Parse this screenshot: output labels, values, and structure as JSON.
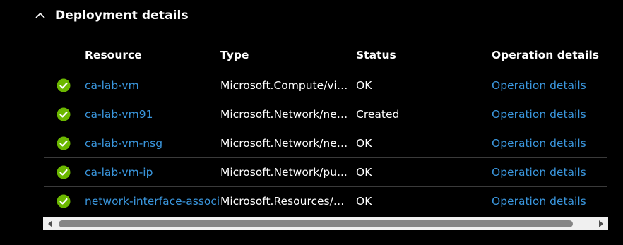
{
  "section": {
    "title": "Deployment details",
    "chevron_icon": "chevron-up-icon"
  },
  "table": {
    "headers": {
      "resource": "Resource",
      "type": "Type",
      "status": "Status",
      "operation": "Operation details"
    },
    "rows": [
      {
        "status_icon": "success-check-icon",
        "resource": "ca-lab-vm",
        "type": "Microsoft.Compute/vir...",
        "status": "OK",
        "operation": "Operation details"
      },
      {
        "status_icon": "success-check-icon",
        "resource": "ca-lab-vm91",
        "type": "Microsoft.Network/net...",
        "status": "Created",
        "operation": "Operation details"
      },
      {
        "status_icon": "success-check-icon",
        "resource": "ca-lab-vm-nsg",
        "type": "Microsoft.Network/net...",
        "status": "OK",
        "operation": "Operation details"
      },
      {
        "status_icon": "success-check-icon",
        "resource": "ca-lab-vm-ip",
        "type": "Microsoft.Network/pu...",
        "status": "OK",
        "operation": "Operation details"
      },
      {
        "status_icon": "success-check-icon",
        "resource": "network-interface-associ",
        "type": "Microsoft.Resources/d...",
        "status": "OK",
        "operation": "Operation details"
      }
    ]
  },
  "colors": {
    "background": "#000000",
    "text": "#ffffff",
    "link": "#3a96dd",
    "success": "#6bb700",
    "row_divider": "#3a3a3a",
    "scrollbar_track": "#f0f0f0",
    "scrollbar_thumb": "#858585"
  },
  "scrollbar": {
    "left_arrow_icon": "scroll-left-arrow-icon",
    "right_arrow_icon": "scroll-right-arrow-icon"
  }
}
